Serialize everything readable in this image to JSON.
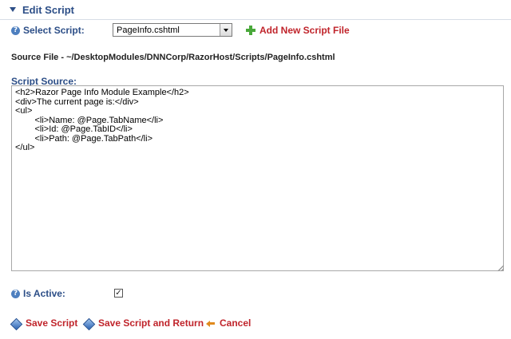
{
  "section": {
    "title": "Edit Script"
  },
  "select_script": {
    "label": "Select Script:",
    "selected": "PageInfo.cshtml"
  },
  "add_new": {
    "label": "Add New Script File"
  },
  "source_file": {
    "text": "Source File - ~/DesktopModules/DNNCorp/RazorHost/Scripts/PageInfo.cshtml"
  },
  "script_source": {
    "label": "Script Source:",
    "content": "<h2>Razor Page Info Module Example</h2>\n<div>The current page is:</div>\n<ul>\n\t<li>Name: @Page.TabName</li>\n\t<li>Id: @Page.TabID</li>\n\t<li>Path: @Page.TabPath</li>\n</ul>"
  },
  "is_active": {
    "label": "Is Active:",
    "checked": true,
    "check_glyph": "✓"
  },
  "actions": {
    "save": "Save Script",
    "save_return": "Save Script and Return",
    "cancel": "Cancel"
  },
  "help_glyph": "?",
  "colors": {
    "label_blue": "#2c4e87",
    "link_red": "#c0242b",
    "plus_green": "#49a83a"
  }
}
